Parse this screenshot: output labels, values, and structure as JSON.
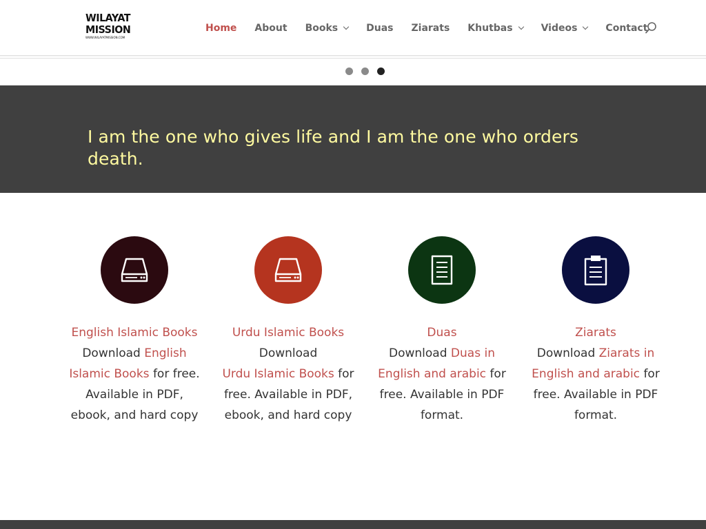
{
  "logo": {
    "line1": "WILAYAT",
    "line2": "MISSION",
    "line3": "WWW.WILAYATMISSION.COM"
  },
  "nav": {
    "items": [
      {
        "label": "Home",
        "active": true,
        "dropdown": false
      },
      {
        "label": "About",
        "active": false,
        "dropdown": false
      },
      {
        "label": "Books",
        "active": false,
        "dropdown": true
      },
      {
        "label": "Duas",
        "active": false,
        "dropdown": false
      },
      {
        "label": "Ziarats",
        "active": false,
        "dropdown": false
      },
      {
        "label": "Khutbas",
        "active": false,
        "dropdown": true
      },
      {
        "label": "Videos",
        "active": false,
        "dropdown": true
      },
      {
        "label": "Contact",
        "active": false,
        "dropdown": false
      }
    ],
    "search_icon": "search-icon"
  },
  "slider": {
    "dot_count": 3,
    "active_index": 2
  },
  "quote": {
    "text": "I am the one who gives life and I am the one who orders death."
  },
  "features": [
    {
      "title": "English Islamic Books",
      "icon": "hard-drive-icon",
      "circle_color": "#2b0a10",
      "prefix": "Download ",
      "link": "English Islamic Books",
      "suffix": " for free. Available in PDF, ebook, and hard copy"
    },
    {
      "title": "Urdu Islamic Books",
      "icon": "hard-drive-icon",
      "circle_color": "#b5341f",
      "prefix": "Download ",
      "link": "Urdu Islamic Books",
      "suffix": " for free. Available in PDF, ebook, and hard copy"
    },
    {
      "title": "Duas",
      "icon": "document-icon",
      "circle_color": "#0c3512",
      "prefix": "Download ",
      "link": "Duas in English and  arabic",
      "suffix": " for free. Available in PDF format."
    },
    {
      "title": "Ziarats",
      "icon": "clipboard-icon",
      "circle_color": "#0a0f40",
      "prefix": "Download ",
      "link": "Ziarats in English and  arabic",
      "suffix": " for free. Available in PDF format."
    }
  ],
  "colors": {
    "accent": "#c0504d",
    "nav_text": "#666666",
    "band": "#404040",
    "quote_text": "#fffaa0"
  }
}
